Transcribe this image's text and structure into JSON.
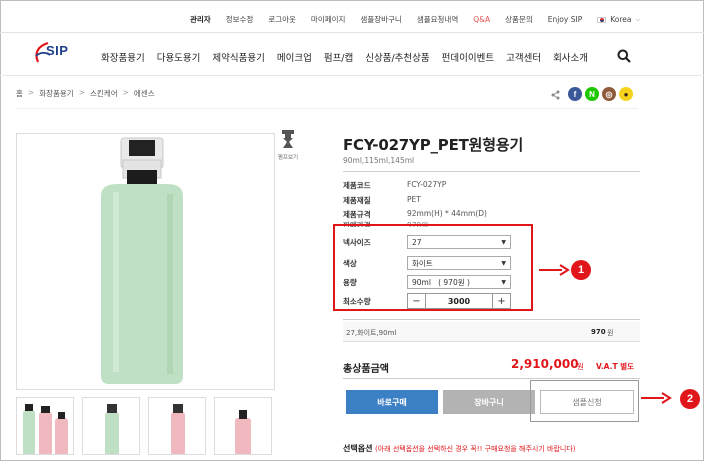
{
  "topbar": {
    "items": [
      "관리자",
      "정보수정",
      "로그아웃",
      "마이페이지",
      "샘플장바구니",
      "샘플요청내역",
      "Q&A",
      "상품문의",
      "Enjoy SIP"
    ],
    "language": "Korea"
  },
  "logo": {
    "text": "SIP"
  },
  "nav": {
    "items": [
      "화장품용기",
      "다용도용기",
      "제약식품용기",
      "메이크업",
      "펌프/캡",
      "신상품/추천상품",
      "펀데이이벤트",
      "고객센터",
      "회사소개"
    ]
  },
  "breadcrumb": [
    "홈",
    "화장품용기",
    "스킨케어",
    "에센스"
  ],
  "social": {
    "facebook": "f",
    "naver": "N",
    "kakao_story": "◎",
    "kakao": "●"
  },
  "zoom": {
    "label": "펌프보기"
  },
  "product": {
    "title": "FCY-027YP_PET원형용기",
    "subtitle": "90ml,115ml,145ml",
    "specs": [
      {
        "key": "제품코드",
        "value": "FCY-027YP"
      },
      {
        "key": "제품재질",
        "value": "PET"
      },
      {
        "key": "제품규격",
        "value": "92mm(H) * 44mm(D)"
      },
      {
        "key": "판매가격",
        "value": "970원"
      }
    ],
    "options": {
      "neck_label": "넥사이즈",
      "neck_value": "27",
      "color_label": "색상",
      "color_value": "화이트",
      "capacity_label": "용량",
      "capacity_value": "90ml   ( 970원 )",
      "min_qty_label": "최소수량",
      "qty_minus": "−",
      "qty_value": "3000",
      "qty_plus": "+"
    },
    "selected": {
      "name": "27,화이트,90ml",
      "price": "970",
      "unit": "원"
    },
    "total": {
      "label": "총상품금액",
      "value": "2,910,000",
      "unit": "원",
      "vat": "V.A.T 별도"
    }
  },
  "buttons": {
    "buy": "바로구매",
    "cart": "장바구니",
    "sample": "샘플신청"
  },
  "choose": {
    "title": "선택옵션",
    "note": "(아래 선택옵션을 선택하신 경우 꼭!! 구매요청을 해주시기 바랍니다)"
  },
  "callouts": {
    "one": "1",
    "two": "2"
  },
  "colors": {
    "accent_red": "#e0161b",
    "buy_blue": "#3b7fc4",
    "bottle_green": "#bfe0c4",
    "bottle_pink": "#f0b8bf"
  }
}
